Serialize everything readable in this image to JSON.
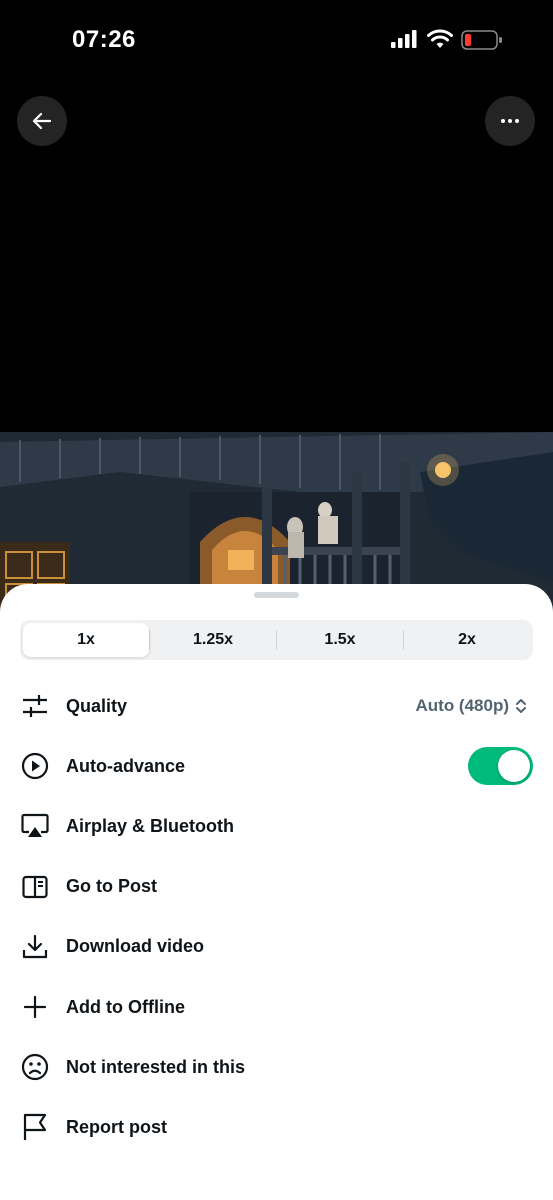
{
  "status_bar": {
    "time": "07:26"
  },
  "speed": {
    "options": [
      "1x",
      "1.25x",
      "1.5x",
      "2x"
    ],
    "selected": "1x"
  },
  "menu": {
    "quality": {
      "label": "Quality",
      "value": "Auto (480p)"
    },
    "auto_advance": {
      "label": "Auto-advance",
      "enabled": true
    },
    "airplay": {
      "label": "Airplay & Bluetooth"
    },
    "go_to_post": {
      "label": "Go to Post"
    },
    "download": {
      "label": "Download video"
    },
    "add_offline": {
      "label": "Add to Offline"
    },
    "not_interested": {
      "label": "Not interested in this"
    },
    "report": {
      "label": "Report post"
    }
  },
  "icons": {
    "back": "arrow-left-icon",
    "more": "more-horizontal-icon",
    "quality": "sliders-icon",
    "auto_advance": "play-circle-icon",
    "airplay": "airplay-icon",
    "go_to_post": "post-panel-icon",
    "download": "download-icon",
    "add_offline": "plus-icon",
    "not_interested": "frown-icon",
    "report": "flag-icon"
  },
  "colors": {
    "toggle_on": "#00ba7c",
    "battery_low": "#ff3b30",
    "secondary_text": "#536471"
  }
}
